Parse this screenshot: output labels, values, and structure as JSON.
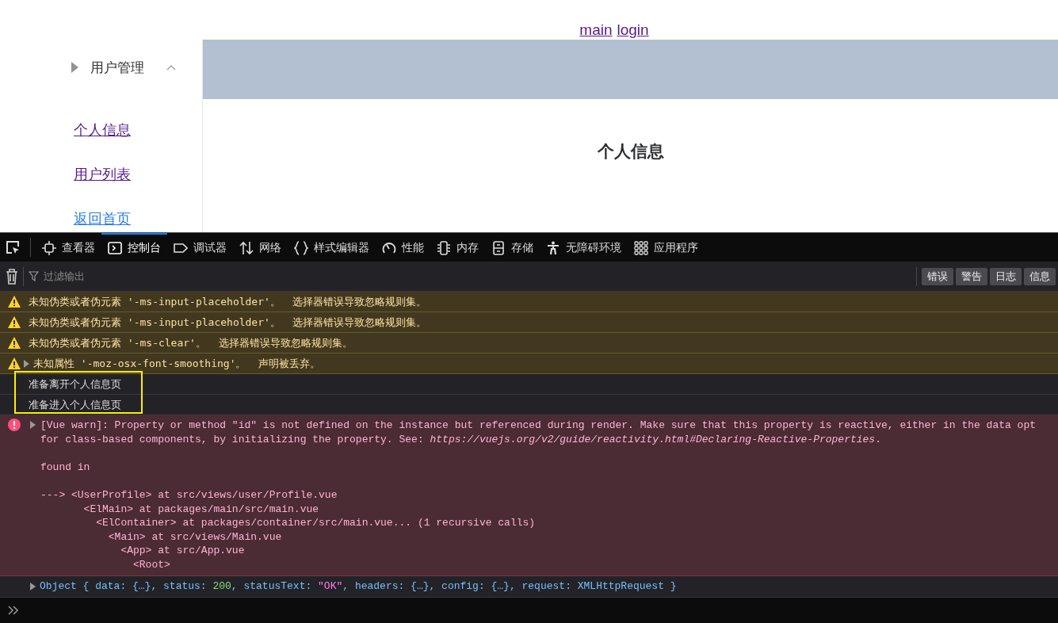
{
  "nav": {
    "links": [
      "main",
      "login"
    ]
  },
  "sidebar": {
    "menu": {
      "title": "用户管理",
      "expanded": true
    },
    "items": [
      {
        "label": "个人信息",
        "visited": true
      },
      {
        "label": "用户列表",
        "visited": true
      },
      {
        "label": "返回首页",
        "visited": false
      }
    ]
  },
  "main": {
    "title": "个人信息"
  },
  "devtools": {
    "tabs": [
      {
        "label": "查看器",
        "selected": false
      },
      {
        "label": "控制台",
        "selected": true
      },
      {
        "label": "调试器",
        "selected": false
      },
      {
        "label": "网络",
        "selected": false
      },
      {
        "label": "样式编辑器",
        "selected": false
      },
      {
        "label": "性能",
        "selected": false
      },
      {
        "label": "内存",
        "selected": false
      },
      {
        "label": "存储",
        "selected": false
      },
      {
        "label": "无障碍环境",
        "selected": false
      },
      {
        "label": "应用程序",
        "selected": false
      }
    ],
    "filter": {
      "placeholder": "过滤输出"
    },
    "levels": [
      "错误",
      "警告",
      "日志",
      "信息"
    ],
    "messages": [
      {
        "kind": "warning",
        "text": "未知伪类或者伪元素 '-ms-input-placeholder'。  选择器错误导致忽略规则集。",
        "expandable": false
      },
      {
        "kind": "warning",
        "text": "未知伪类或者伪元素 '-ms-input-placeholder'。  选择器错误导致忽略规则集。",
        "expandable": false
      },
      {
        "kind": "warning",
        "text": "未知伪类或者伪元素 '-ms-clear'。  选择器错误导致忽略规则集。",
        "expandable": false
      },
      {
        "kind": "warning",
        "text": "未知属性 '-moz-osx-font-smoothing'。  声明被丢弃。",
        "expandable": true
      },
      {
        "kind": "group",
        "highlighted": true,
        "children": [
          {
            "kind": "log",
            "text": "准备离开个人信息页"
          },
          {
            "kind": "log",
            "text": "准备进入个人信息页"
          }
        ]
      },
      {
        "kind": "error",
        "expandable": true,
        "message_lines": [
          "[Vue warn]: Property or method \"id\" is not defined on the instance but referenced during render. Make sure that this property is reactive, either in the data opt",
          "for class-based components, by initializing the property. See: *https://vuejs.org/v2/guide/reactivity.html#Declaring-Reactive-Properties*."
        ],
        "found_in": "found in",
        "trace": [
          "---> <UserProfile> at src/views/user/Profile.vue",
          "       <ElMain> at packages/main/src/main.vue",
          "         <ElContainer> at packages/container/src/main.vue... (1 recursive calls)",
          "           <Main> at src/views/Main.vue",
          "             <App> at src/App.vue",
          "               <Root>"
        ]
      },
      {
        "kind": "object",
        "expandable": true,
        "parts": [
          {
            "kind": "key",
            "text": "Object { data: {…}, status: "
          },
          {
            "kind": "number",
            "text": "200"
          },
          {
            "kind": "key",
            "text": ", statusText: "
          },
          {
            "kind": "string",
            "text": "\"OK\""
          },
          {
            "kind": "key",
            "text": ", headers: {…}, config: {…}, request: XMLHttpRequest }"
          }
        ]
      }
    ]
  }
}
